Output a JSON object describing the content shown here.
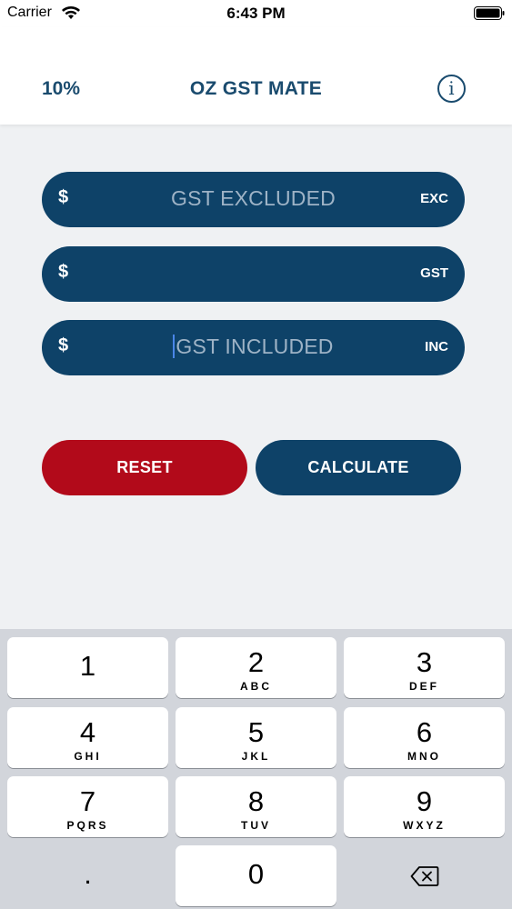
{
  "status_bar": {
    "carrier": "Carrier",
    "time": "6:43 PM"
  },
  "nav": {
    "rate": "10%",
    "title": "OZ GST MATE",
    "info_glyph": "i"
  },
  "fields": {
    "exc": {
      "currency": "$",
      "placeholder": "GST EXCLUDED",
      "suffix": "EXC"
    },
    "gst": {
      "currency": "$",
      "placeholder": "",
      "suffix": "GST"
    },
    "inc": {
      "currency": "$",
      "placeholder": "GST INCLUDED",
      "suffix": "INC"
    }
  },
  "buttons": {
    "reset": "RESET",
    "calculate": "CALCULATE"
  },
  "keyboard": {
    "keys": [
      {
        "digit": "1",
        "letters": ""
      },
      {
        "digit": "2",
        "letters": "ABC"
      },
      {
        "digit": "3",
        "letters": "DEF"
      },
      {
        "digit": "4",
        "letters": "GHI"
      },
      {
        "digit": "5",
        "letters": "JKL"
      },
      {
        "digit": "6",
        "letters": "MNO"
      },
      {
        "digit": "7",
        "letters": "PQRS"
      },
      {
        "digit": "8",
        "letters": "TUV"
      },
      {
        "digit": "9",
        "letters": "WXYZ"
      },
      {
        "digit": "0",
        "letters": ""
      }
    ],
    "decimal": ".",
    "delete_icon": "backspace-icon"
  },
  "colors": {
    "primary": "#0e4268",
    "reset": "#b20a1a",
    "title": "#1a4b6e",
    "placeholder": "#9eb3c6",
    "keyboard_bg": "#d2d5db"
  }
}
